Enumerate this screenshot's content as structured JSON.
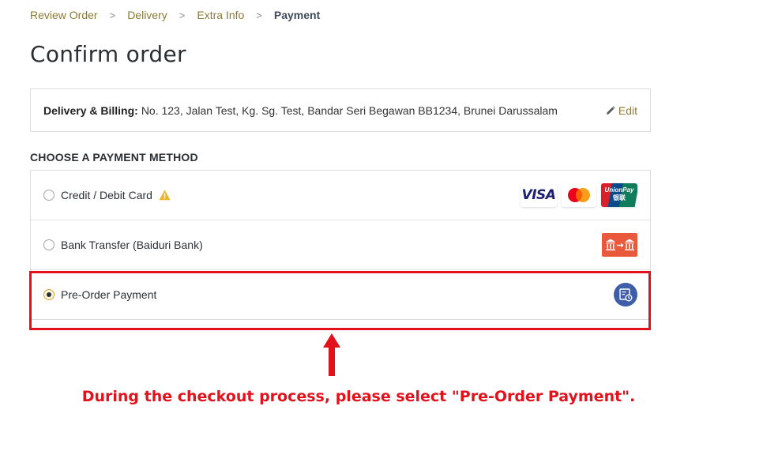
{
  "breadcrumb": {
    "items": [
      "Review Order",
      "Delivery",
      "Extra Info"
    ],
    "current": "Payment",
    "separator": ">"
  },
  "page_title": "Confirm order",
  "address": {
    "label": "Delivery & Billing:",
    "value": "No. 123, Jalan Test, Kg. Sg. Test, Bandar Seri Begawan BB1234, Brunei Darussalam",
    "edit_label": "Edit",
    "edit_icon": "pencil-icon"
  },
  "payment": {
    "heading": "CHOOSE A PAYMENT METHOD",
    "methods": [
      {
        "label": "Credit / Debit Card",
        "selected": false,
        "icons": [
          "warning-icon",
          "visa-logo",
          "mastercard-logo",
          "unionpay-logo"
        ]
      },
      {
        "label": "Bank Transfer (Baiduri Bank)",
        "selected": false,
        "icons": [
          "bank-transfer-icon"
        ]
      },
      {
        "label": "Pre-Order Payment",
        "selected": true,
        "icons": [
          "pre-order-icon"
        ]
      }
    ],
    "logos": {
      "visa": "VISA",
      "unionpay": "UnionPay",
      "unionpay_cn": "银联"
    }
  },
  "annotation": {
    "instruction": "During the checkout process, please select \"Pre-Order Payment\".",
    "color": "#e3111c"
  },
  "colors": {
    "accent": "#8a7a33",
    "radio_selected": "#d9a52e",
    "bank_badge": "#e95a3c",
    "preorder_badge": "#3f5ea8"
  }
}
